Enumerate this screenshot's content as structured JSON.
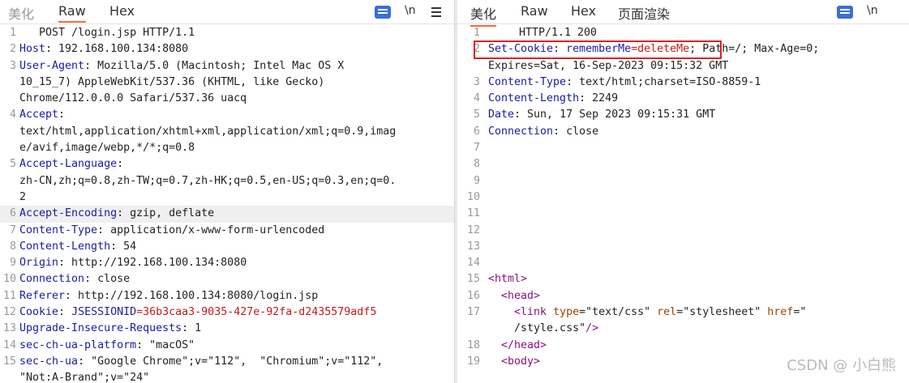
{
  "request": {
    "tabs": [
      {
        "label": "美化",
        "active": false
      },
      {
        "label": "Raw",
        "active": true
      },
      {
        "label": "Hex",
        "active": false
      }
    ],
    "tools": {
      "wrap": "wrap",
      "newline": "\\n",
      "menu": "menu"
    },
    "lines": [
      {
        "n": "1",
        "parts": [
          {
            "c": "tx",
            "t": "POST /login.jsp HTTP/1.1"
          }
        ]
      },
      {
        "n": "2",
        "parts": [
          {
            "c": "k",
            "t": "Host"
          },
          {
            "c": "v",
            "t": ": 192.168.100.134:8080"
          }
        ]
      },
      {
        "n": "3",
        "parts": [
          {
            "c": "k",
            "t": "User-Agent"
          },
          {
            "c": "v",
            "t": ": Mozilla/5.0 (Macintosh; Intel Mac OS X"
          }
        ]
      },
      {
        "n": "",
        "parts": [
          {
            "c": "v",
            "t": "10_15_7) AppleWebKit/537.36 (KHTML, like Gecko)"
          }
        ]
      },
      {
        "n": "",
        "parts": [
          {
            "c": "v",
            "t": "Chrome/112.0.0.0 Safari/537.36 uacq"
          }
        ]
      },
      {
        "n": "4",
        "parts": [
          {
            "c": "k",
            "t": "Accept"
          },
          {
            "c": "v",
            "t": ":"
          }
        ]
      },
      {
        "n": "",
        "parts": [
          {
            "c": "v",
            "t": "text/html,application/xhtml+xml,application/xml;q=0.9,imag"
          }
        ]
      },
      {
        "n": "",
        "parts": [
          {
            "c": "v",
            "t": "e/avif,image/webp,*/*;q=0.8"
          }
        ]
      },
      {
        "n": "5",
        "parts": [
          {
            "c": "k",
            "t": "Accept-Language"
          },
          {
            "c": "v",
            "t": ":"
          }
        ]
      },
      {
        "n": "",
        "parts": [
          {
            "c": "v",
            "t": "zh-CN,zh;q=0.8,zh-TW;q=0.7,zh-HK;q=0.5,en-US;q=0.3,en;q=0."
          }
        ]
      },
      {
        "n": "",
        "parts": [
          {
            "c": "v",
            "t": "2"
          }
        ]
      },
      {
        "n": "6",
        "hl": true,
        "parts": [
          {
            "c": "k",
            "t": "Accept-Encoding"
          },
          {
            "c": "v",
            "t": ": gzip, deflate"
          }
        ]
      },
      {
        "n": "7",
        "parts": [
          {
            "c": "k",
            "t": "Content-Type"
          },
          {
            "c": "v",
            "t": ": application/x-www-form-urlencoded"
          }
        ]
      },
      {
        "n": "8",
        "parts": [
          {
            "c": "k",
            "t": "Content-Length"
          },
          {
            "c": "v",
            "t": ": 54"
          }
        ]
      },
      {
        "n": "9",
        "parts": [
          {
            "c": "k",
            "t": "Origin"
          },
          {
            "c": "v",
            "t": ": http://192.168.100.134:8080"
          }
        ]
      },
      {
        "n": "10",
        "parts": [
          {
            "c": "k",
            "t": "Connection"
          },
          {
            "c": "v",
            "t": ": close"
          }
        ]
      },
      {
        "n": "11",
        "parts": [
          {
            "c": "k",
            "t": "Referer"
          },
          {
            "c": "v",
            "t": ": http://192.168.100.134:8080/login.jsp"
          }
        ]
      },
      {
        "n": "12",
        "parts": [
          {
            "c": "k",
            "t": "Cookie"
          },
          {
            "c": "v",
            "t": ": "
          },
          {
            "c": "k",
            "t": "JSESSIONID"
          },
          {
            "c": "red",
            "t": "=36b3caa3-9035-427e-92fa-d2435579adf5"
          }
        ]
      },
      {
        "n": "13",
        "parts": [
          {
            "c": "k",
            "t": "Upgrade-Insecure-Requests"
          },
          {
            "c": "v",
            "t": ": 1"
          }
        ]
      },
      {
        "n": "14",
        "parts": [
          {
            "c": "k",
            "t": "sec-ch-ua-platform"
          },
          {
            "c": "v",
            "t": ": \"macOS\""
          }
        ]
      },
      {
        "n": "15",
        "parts": [
          {
            "c": "k",
            "t": "sec-ch-ua"
          },
          {
            "c": "v",
            "t": ": \"Google Chrome\";v=\"112\",  \"Chromium\";v=\"112\","
          }
        ]
      },
      {
        "n": "",
        "parts": [
          {
            "c": "v",
            "t": "\"Not:A-Brand\";v=\"24\""
          }
        ]
      }
    ]
  },
  "response": {
    "tabs": [
      {
        "label": "美化",
        "active": true
      },
      {
        "label": "Raw",
        "active": false
      },
      {
        "label": "Hex",
        "active": false
      },
      {
        "label": "页面渲染",
        "active": false
      }
    ],
    "tools": {
      "wrap": "wrap",
      "newline": "\\n"
    },
    "lines": [
      {
        "n": "1",
        "parts": [
          {
            "c": "tx",
            "t": "HTTP/1.1 200"
          }
        ]
      },
      {
        "n": "2",
        "parts": [
          {
            "c": "k",
            "t": "Set-Cookie"
          },
          {
            "c": "v",
            "t": ": "
          },
          {
            "c": "k",
            "t": "rememberMe"
          },
          {
            "c": "red",
            "t": "=deleteMe"
          },
          {
            "c": "v",
            "t": "; Path=/; Max-Age=0;"
          }
        ]
      },
      {
        "n": "",
        "parts": [
          {
            "c": "v",
            "t": "Expires=Sat, 16-Sep-2023 09:15:32 GMT"
          }
        ]
      },
      {
        "n": "3",
        "parts": [
          {
            "c": "k",
            "t": "Content-Type"
          },
          {
            "c": "v",
            "t": ": text/html;charset=ISO-8859-1"
          }
        ]
      },
      {
        "n": "4",
        "parts": [
          {
            "c": "k",
            "t": "Content-Length"
          },
          {
            "c": "v",
            "t": ": 2249"
          }
        ]
      },
      {
        "n": "5",
        "parts": [
          {
            "c": "k",
            "t": "Date"
          },
          {
            "c": "v",
            "t": ": Sun, 17 Sep 2023 09:15:31 GMT"
          }
        ]
      },
      {
        "n": "6",
        "parts": [
          {
            "c": "k",
            "t": "Connection"
          },
          {
            "c": "v",
            "t": ": close"
          }
        ]
      },
      {
        "n": "7",
        "parts": []
      },
      {
        "n": "8",
        "parts": []
      },
      {
        "n": "9",
        "parts": []
      },
      {
        "n": "10",
        "parts": []
      },
      {
        "n": "11",
        "parts": []
      },
      {
        "n": "12",
        "parts": []
      },
      {
        "n": "13",
        "parts": []
      },
      {
        "n": "14",
        "parts": []
      },
      {
        "n": "15",
        "parts": [
          {
            "c": "tag",
            "t": "<html>"
          }
        ]
      },
      {
        "n": "16",
        "parts": [
          {
            "c": "tag",
            "t": "  <head>"
          }
        ]
      },
      {
        "n": "17",
        "parts": [
          {
            "c": "tag",
            "t": "    <link "
          },
          {
            "c": "attr",
            "t": "type"
          },
          {
            "c": "str",
            "t": "=\"text/css\" "
          },
          {
            "c": "attr",
            "t": "rel"
          },
          {
            "c": "str",
            "t": "=\"stylesheet\" "
          },
          {
            "c": "attr",
            "t": "href"
          },
          {
            "c": "str",
            "t": "=\""
          }
        ]
      },
      {
        "n": "",
        "parts": [
          {
            "c": "str",
            "t": "    /style.css\""
          },
          {
            "c": "tag",
            "t": "/>"
          }
        ]
      },
      {
        "n": "18",
        "parts": [
          {
            "c": "tag",
            "t": "  </head>"
          }
        ]
      },
      {
        "n": "19",
        "parts": [
          {
            "c": "tag",
            "t": "  <body>"
          }
        ]
      },
      {
        "n": "",
        "parts": []
      }
    ]
  },
  "watermark": "CSDN @ 小白熊"
}
